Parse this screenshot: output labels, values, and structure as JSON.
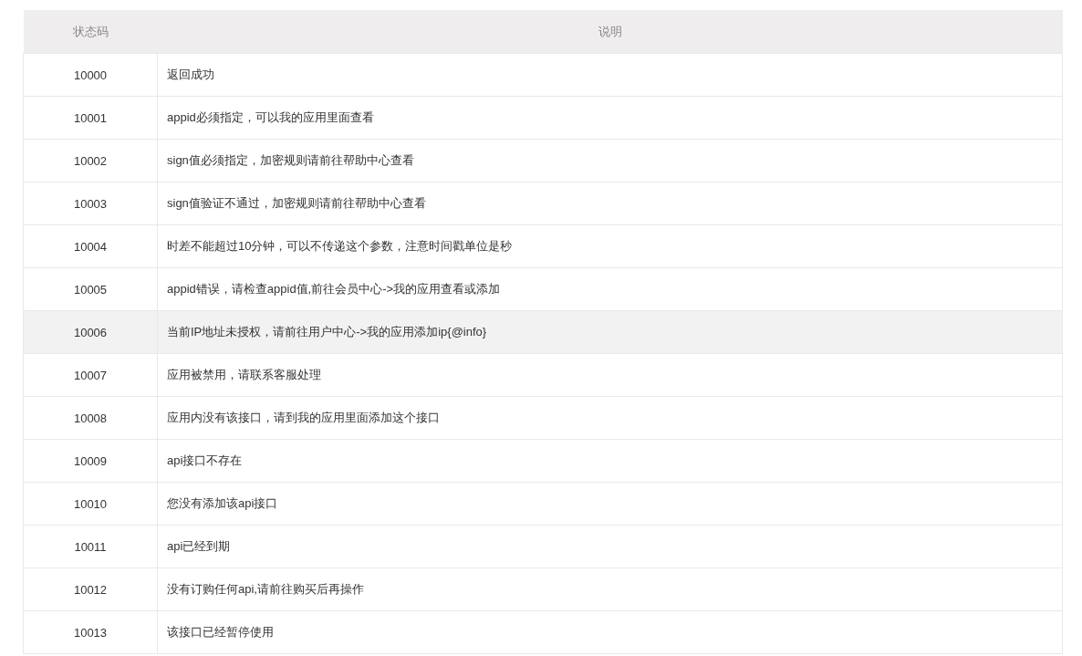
{
  "table": {
    "columns": [
      "状态码",
      "说明"
    ],
    "rows": [
      {
        "code": "10000",
        "description": "返回成功",
        "highlighted": false
      },
      {
        "code": "10001",
        "description": "appid必须指定，可以我的应用里面查看",
        "highlighted": false
      },
      {
        "code": "10002",
        "description": "sign值必须指定，加密规则请前往帮助中心查看",
        "highlighted": false
      },
      {
        "code": "10003",
        "description": "sign值验证不通过，加密规则请前往帮助中心查看",
        "highlighted": false
      },
      {
        "code": "10004",
        "description": "时差不能超过10分钟，可以不传递这个参数，注意时间戳单位是秒",
        "highlighted": false
      },
      {
        "code": "10005",
        "description": "appid错误，请检查appid值,前往会员中心->我的应用查看或添加",
        "highlighted": false
      },
      {
        "code": "10006",
        "description": "当前IP地址未授权，请前往用户中心->我的应用添加ip{@info}",
        "highlighted": true
      },
      {
        "code": "10007",
        "description": "应用被禁用，请联系客服处理",
        "highlighted": false
      },
      {
        "code": "10008",
        "description": "应用内没有该接口，请到我的应用里面添加这个接口",
        "highlighted": false
      },
      {
        "code": "10009",
        "description": "api接口不存在",
        "highlighted": false
      },
      {
        "code": "10010",
        "description": "您没有添加该api接口",
        "highlighted": false
      },
      {
        "code": "10011",
        "description": "api已经到期",
        "highlighted": false
      },
      {
        "code": "10012",
        "description": "没有订购任何api,请前往购买后再操作",
        "highlighted": false
      },
      {
        "code": "10013",
        "description": "该接口已经暂停使用",
        "highlighted": false
      }
    ]
  }
}
